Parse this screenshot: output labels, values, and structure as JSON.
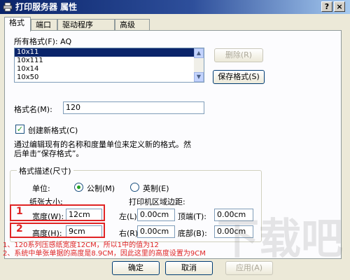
{
  "window": {
    "title": "打印服务器 属性",
    "controls": {
      "help": "?",
      "close": "×"
    }
  },
  "tabs": [
    {
      "label": "格式",
      "active": true
    },
    {
      "label": "端口",
      "active": false
    },
    {
      "label": "驱动程序",
      "active": false
    },
    {
      "label": "高级",
      "active": false
    }
  ],
  "forms": {
    "label": "所有格式(F): AQ",
    "items": [
      "10x11",
      "10x111",
      "10x14",
      "10x50"
    ],
    "selected": "10x11"
  },
  "buttons": {
    "delete": "删除(R)",
    "save_format": "保存格式(S)",
    "ok": "确定",
    "cancel": "取消",
    "apply": "应用(A)"
  },
  "format_name": {
    "label": "格式名(M):",
    "value": "120"
  },
  "create_new": {
    "label": "创建新格式(C)",
    "checked": true
  },
  "help_text": {
    "line1": "通过编辑现有的名称和度量单位来定义新的格式。然",
    "line2": "后单击“保存格式”。"
  },
  "group": {
    "title": "格式描述(尺寸)",
    "units_label": "单位:",
    "unit_metric": "公制(M)",
    "unit_imperial": "英制(E)",
    "unit_selected": "metric",
    "paper_size_label": "纸张大小:",
    "margins_label": "打印机区域边距:",
    "width": {
      "label": "宽度(W):",
      "value": "12cm"
    },
    "height": {
      "label": "高度(H):",
      "value": "9cm"
    },
    "left": {
      "label": "左(L):",
      "value": "0.00cm"
    },
    "right": {
      "label": "右(R):",
      "value": "0.00cm"
    },
    "top": {
      "label": "顶端(T):",
      "value": "0.00cm"
    },
    "bottom": {
      "label": "底部(B):",
      "value": "0.00cm"
    }
  },
  "annotations": {
    "mark1": "1",
    "mark2": "2",
    "note1": "1、120系列压感纸宽度12CM，所以1中的值为12",
    "note2": "2、系统中单张单据的高度是8.9CM，因此这里的高度设置为9CM"
  },
  "watermark": "下载吧",
  "colors": {
    "title_bar": "#0a246a",
    "annotation": "#e02424",
    "selection": "#0a246a"
  }
}
